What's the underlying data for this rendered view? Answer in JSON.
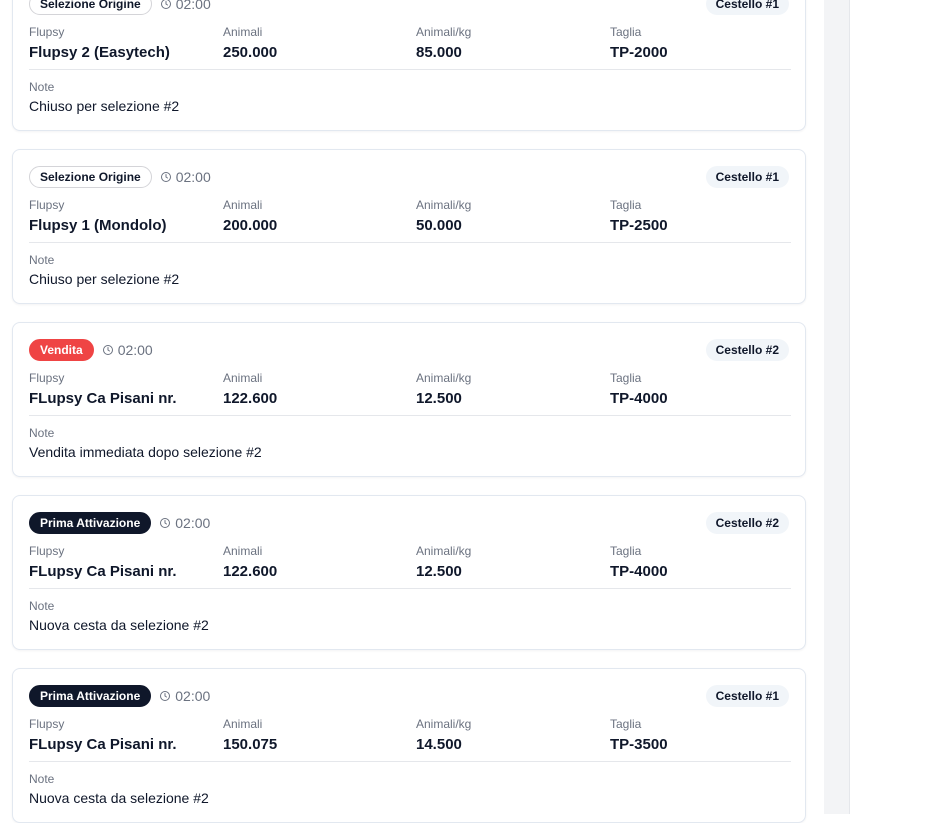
{
  "cards": [
    {
      "badge": "Selezione Origine",
      "badge_style": "selezione",
      "time": "02:00",
      "cestello": "Cestello #1",
      "flupsy_label": "Flupsy",
      "flupsy": "Flupsy 2 (Easytech)",
      "animali_label": "Animali",
      "animali": "250.000",
      "animali_kg_label": "Animali/kg",
      "animali_kg": "85.000",
      "taglia_label": "Taglia",
      "taglia": "TP-2000",
      "note_label": "Note",
      "note": "Chiuso per selezione #2"
    },
    {
      "badge": "Selezione Origine",
      "badge_style": "selezione",
      "time": "02:00",
      "cestello": "Cestello #1",
      "flupsy_label": "Flupsy",
      "flupsy": "Flupsy 1 (Mondolo)",
      "animali_label": "Animali",
      "animali": "200.000",
      "animali_kg_label": "Animali/kg",
      "animali_kg": "50.000",
      "taglia_label": "Taglia",
      "taglia": "TP-2500",
      "note_label": "Note",
      "note": "Chiuso per selezione #2"
    },
    {
      "badge": "Vendita",
      "badge_style": "vendita",
      "time": "02:00",
      "cestello": "Cestello #2",
      "flupsy_label": "Flupsy",
      "flupsy": "FLupsy Ca Pisani nr.",
      "animali_label": "Animali",
      "animali": "122.600",
      "animali_kg_label": "Animali/kg",
      "animali_kg": "12.500",
      "taglia_label": "Taglia",
      "taglia": "TP-4000",
      "note_label": "Note",
      "note": "Vendita immediata dopo selezione #2"
    },
    {
      "badge": "Prima Attivazione",
      "badge_style": "prima",
      "time": "02:00",
      "cestello": "Cestello #2",
      "flupsy_label": "Flupsy",
      "flupsy": "FLupsy Ca Pisani nr.",
      "animali_label": "Animali",
      "animali": "122.600",
      "animali_kg_label": "Animali/kg",
      "animali_kg": "12.500",
      "taglia_label": "Taglia",
      "taglia": "TP-4000",
      "note_label": "Note",
      "note": "Nuova cesta da selezione #2"
    },
    {
      "badge": "Prima Attivazione",
      "badge_style": "prima",
      "time": "02:00",
      "cestello": "Cestello #1",
      "flupsy_label": "Flupsy",
      "flupsy": "FLupsy Ca Pisani nr.",
      "animali_label": "Animali",
      "animali": "150.075",
      "animali_kg_label": "Animali/kg",
      "animali_kg": "14.500",
      "taglia_label": "Taglia",
      "taglia": "TP-3500",
      "note_label": "Note",
      "note": "Nuova cesta da selezione #2"
    }
  ],
  "icons": {
    "time": "clock-icon"
  },
  "colors": {
    "vendita": "#ef4444",
    "prima_attivazione": "#0f172a",
    "border": "#e2e8f0",
    "muted": "#6b7280"
  }
}
